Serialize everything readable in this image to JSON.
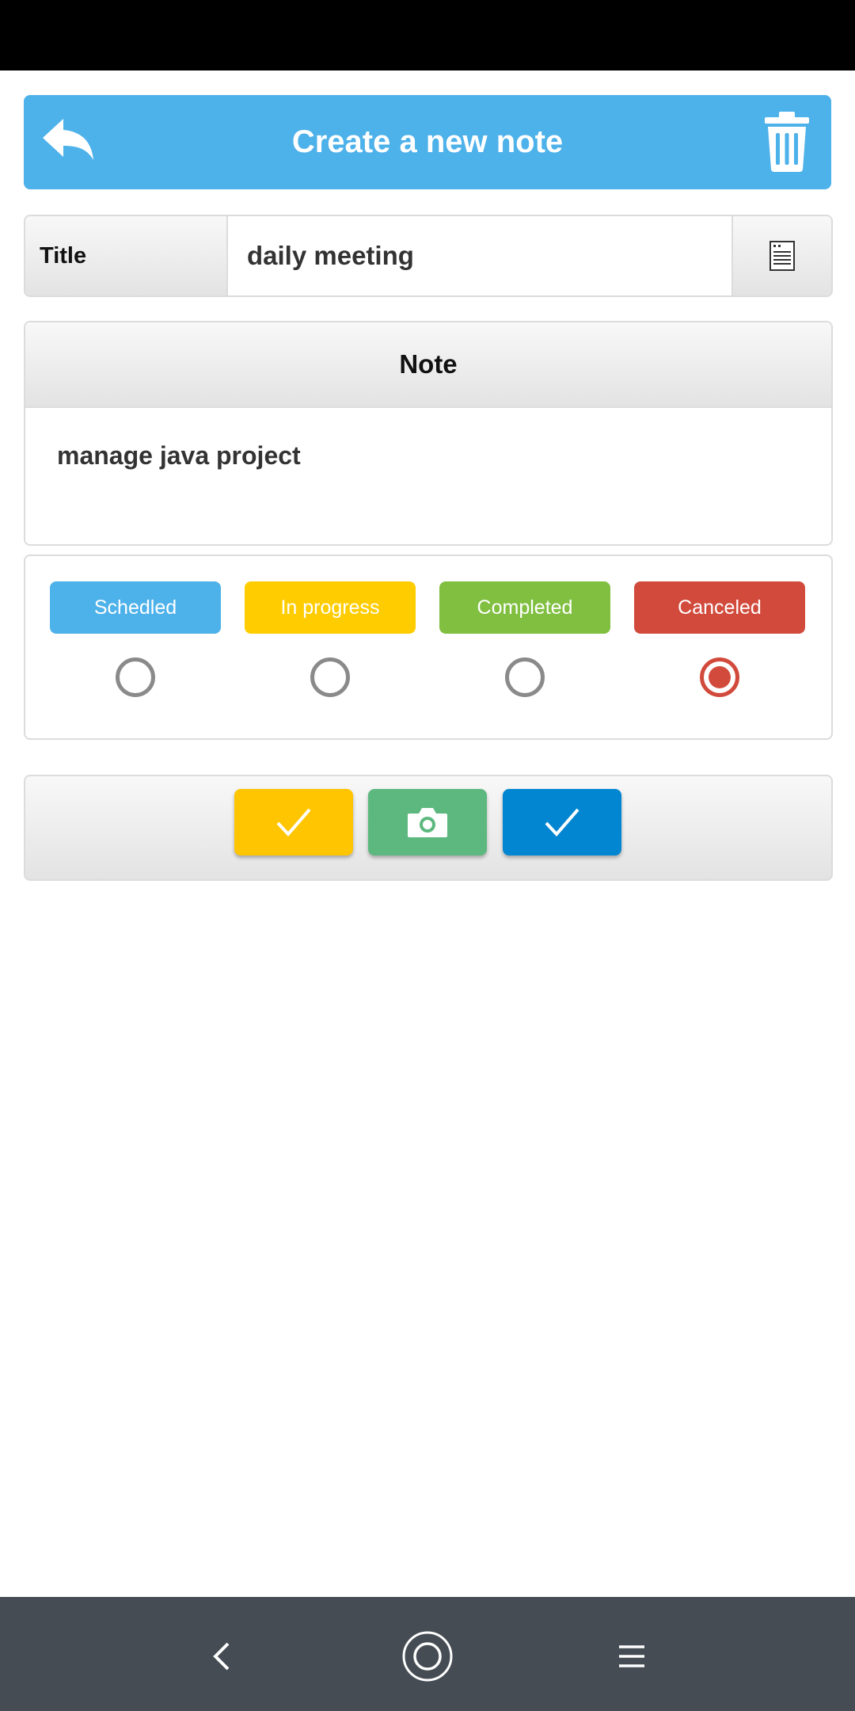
{
  "header": {
    "title": "Create a new note",
    "back_icon": "reply-arrow-icon",
    "delete_icon": "trash-icon",
    "color": "#4db1ea"
  },
  "title_field": {
    "label": "Title",
    "value": "daily meeting",
    "doc_icon": "document-icon"
  },
  "note": {
    "header": "Note",
    "body": "manage java project"
  },
  "status": {
    "options": [
      {
        "label": "Schedled",
        "color": "#4db1ea",
        "selected": false
      },
      {
        "label": "In progress",
        "color": "#ffcc00",
        "selected": false
      },
      {
        "label": "Completed",
        "color": "#80bf40",
        "selected": false
      },
      {
        "label": "Canceled",
        "color": "#d14a3c",
        "selected": true
      }
    ]
  },
  "actions": [
    {
      "name": "yellow-check-button",
      "icon": "check-icon",
      "color": "#ffc500"
    },
    {
      "name": "camera-button",
      "icon": "camera-icon",
      "color": "#5cb87f"
    },
    {
      "name": "blue-check-button",
      "icon": "check-icon",
      "color": "#0286d1"
    }
  ],
  "system_nav": {
    "back_icon": "chevron-left-icon",
    "home_icon": "home-circle-icon",
    "menu_icon": "menu-icon"
  }
}
